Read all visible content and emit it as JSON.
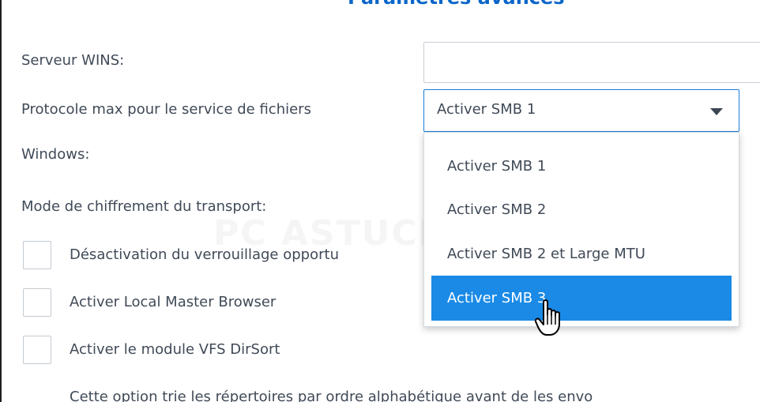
{
  "dialog": {
    "title": "Paramètres avancés"
  },
  "form": {
    "wins_label": "Serveur WINS:",
    "wins_value": "",
    "protocol_label": "Protocole max pour le service de fichiers",
    "protocol_label_cont": "Windows:",
    "protocol_selected": "Activer SMB 1",
    "transport_label": "Mode de chiffrement du transport:"
  },
  "dropdown": {
    "options": [
      "Activer SMB 1",
      "Activer SMB 2",
      "Activer SMB 2 et Large MTU",
      "Activer SMB 3"
    ],
    "highlighted_index": 3,
    "highlight_color": "#1a8ae6"
  },
  "checkboxes": [
    {
      "label": "Désactivation du verrouillage opportu",
      "checked": false
    },
    {
      "label": "Activer Local Master Browser",
      "checked": false
    },
    {
      "label": "Activer le module VFS DirSort",
      "checked": false
    }
  ],
  "help_text": "Cette option trie les répertoires par ordre alphabétique avant de les envo",
  "watermark": "PC ASTUCES",
  "icons": {
    "dropdown_arrow": "caret-down-icon",
    "cursor": "hand-pointer-icon"
  },
  "colors": {
    "accent": "#1b7ed9",
    "title": "#0a66c9",
    "text": "#404a57"
  }
}
